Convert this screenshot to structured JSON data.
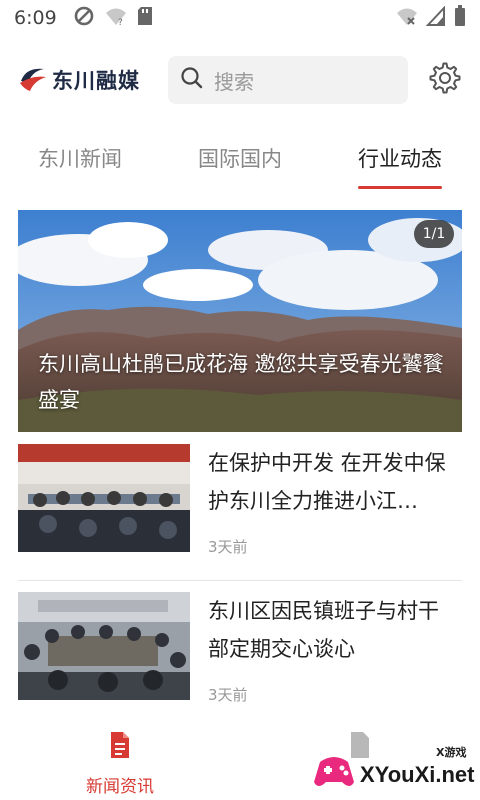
{
  "status_bar": {
    "time": "6:09"
  },
  "header": {
    "logo_text": "东川融媒",
    "search_placeholder": "搜索"
  },
  "tabs": [
    {
      "label": "东川新闻",
      "active": false
    },
    {
      "label": "国际国内",
      "active": false
    },
    {
      "label": "行业动态",
      "active": true
    }
  ],
  "featured": {
    "badge": "1/1",
    "title": "东川高山杜鹃已成花海 邀您共享受春光饕餮盛宴"
  },
  "news": [
    {
      "title": "在保护中开发 在开发中保护东川全力推进小江…",
      "time": "3天前"
    },
    {
      "title": "东川区因民镇班子与村干部定期交心谈心",
      "time": "3天前"
    }
  ],
  "bottom_nav": {
    "items": [
      {
        "label": "新闻资讯",
        "icon": "news-document-icon",
        "active": true
      }
    ]
  },
  "watermark": {
    "main": "XYouXi.net",
    "small": "X游戏"
  },
  "colors": {
    "accent": "#d63a32",
    "logo": "#1f2a44"
  }
}
